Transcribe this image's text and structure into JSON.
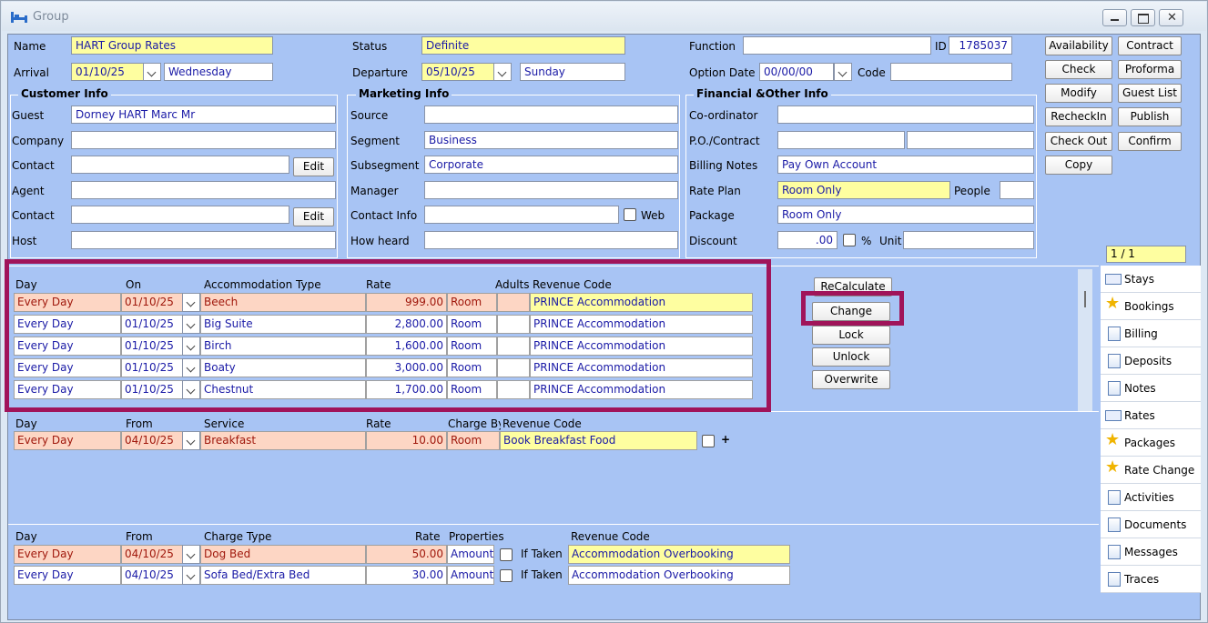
{
  "window": {
    "title": "Group"
  },
  "header": {
    "name_label": "Name",
    "name_value": "HART Group Rates",
    "status_label": "Status",
    "status_value": "Definite",
    "function_label": "Function",
    "function_value": "",
    "id_label": "ID",
    "id_value": "1785037",
    "arrival_label": "Arrival",
    "arrival_date": "01/10/25",
    "arrival_day": "Wednesday",
    "departure_label": "Departure",
    "departure_date": "05/10/25",
    "departure_day": "Sunday",
    "option_date_label": "Option Date",
    "option_date_value": "00/00/00",
    "code_label": "Code",
    "code_value": ""
  },
  "customer": {
    "title": "Customer Info",
    "guest_label": "Guest",
    "guest_value": "Dorney HART Marc Mr",
    "company_label": "Company",
    "company_value": "",
    "contact_label": "Contact",
    "contact_value": "",
    "edit1": "Edit",
    "agent_label": "Agent",
    "agent_value": "",
    "contact2_label": "Contact",
    "contact2_value": "",
    "edit2": "Edit",
    "host_label": "Host",
    "host_value": ""
  },
  "marketing": {
    "title": "Marketing Info",
    "source_label": "Source",
    "source_value": "",
    "segment_label": "Segment",
    "segment_value": "Business",
    "subsegment_label": "Subsegment",
    "subsegment_value": "Corporate",
    "manager_label": "Manager",
    "manager_value": "",
    "contactinfo_label": "Contact Info",
    "contactinfo_value": "",
    "web_label": "Web",
    "howheard_label": "How heard",
    "howheard_value": ""
  },
  "financial": {
    "title": "Financial &Other Info",
    "coordinator_label": "Co-ordinator",
    "coordinator_value": "",
    "po_label": "P.O./Contract",
    "po_value": "",
    "po_value2": "",
    "billing_label": "Billing Notes",
    "billing_value": "Pay Own Account",
    "rateplan_label": "Rate Plan",
    "rateplan_value": "Room Only",
    "people_label": "People",
    "people_value": "",
    "package_label": "Package",
    "package_value": "Room Only",
    "discount_label": "Discount",
    "discount_value": ".00",
    "pct_label": "%",
    "unit_label": "Unit",
    "unit_value": ""
  },
  "actions": {
    "availability": "Availability",
    "contract": "Contract",
    "check": "Check",
    "proforma": "Proforma",
    "modify": "Modify",
    "guest_list": "Guest List",
    "recheckin": "RecheckIn",
    "publish": "Publish",
    "check_out": "Check Out",
    "confirm": "Confirm",
    "copy": "Copy"
  },
  "pager": "1 / 1",
  "accommodation": {
    "headers": {
      "day": "Day",
      "on": "On",
      "type": "Accommodation Type",
      "rate": "Rate",
      "adults": "Adults",
      "revenue": "Revenue Code"
    },
    "rows": [
      {
        "day": "Every Day",
        "on": "01/10/25",
        "type": "Beech",
        "rate": "999.00",
        "unit": "Room",
        "adults": "",
        "revenue": "PRINCE Accommodation"
      },
      {
        "day": "Every Day",
        "on": "01/10/25",
        "type": "Big Suite",
        "rate": "2,800.00",
        "unit": "Room",
        "adults": "",
        "revenue": "PRINCE Accommodation"
      },
      {
        "day": "Every Day",
        "on": "01/10/25",
        "type": "Birch",
        "rate": "1,600.00",
        "unit": "Room",
        "adults": "",
        "revenue": "PRINCE Accommodation"
      },
      {
        "day": "Every Day",
        "on": "01/10/25",
        "type": "Boaty",
        "rate": "3,000.00",
        "unit": "Room",
        "adults": "",
        "revenue": "PRINCE Accommodation"
      },
      {
        "day": "Every Day",
        "on": "01/10/25",
        "type": "Chestnut",
        "rate": "1,700.00",
        "unit": "Room",
        "adults": "",
        "revenue": "PRINCE Accommodation"
      }
    ],
    "recalculate": "ReCalculate",
    "change": "Change",
    "lock": "Lock",
    "unlock": "Unlock",
    "overwrite": "Overwrite"
  },
  "services": {
    "headers": {
      "day": "Day",
      "from": "From",
      "service": "Service",
      "rate": "Rate",
      "charge_by": "Charge By",
      "revenue": "Revenue Code"
    },
    "rows": [
      {
        "day": "Every Day",
        "from": "04/10/25",
        "service": "Breakfast",
        "rate": "10.00",
        "unit": "Room",
        "revenue": "Book Breakfast Food",
        "plus": "+"
      }
    ]
  },
  "charges": {
    "headers": {
      "day": "Day",
      "from": "From",
      "type": "Charge Type",
      "rate": "Rate",
      "properties": "Properties",
      "revenue": "Revenue Code"
    },
    "rows": [
      {
        "day": "Every Day",
        "from": "04/10/25",
        "type": "Dog Bed",
        "rate": "50.00",
        "unit": "Amount",
        "iftaken": "If Taken",
        "revenue": "Accommodation Overbooking"
      },
      {
        "day": "Every Day",
        "from": "04/10/25",
        "type": "Sofa Bed/Extra Bed",
        "rate": "30.00",
        "unit": "Amount",
        "iftaken": "If Taken",
        "revenue": "Accommodation Overbooking"
      }
    ]
  },
  "sidebar": {
    "items": [
      {
        "label": "Stays",
        "icon": "message-icon"
      },
      {
        "label": "Bookings",
        "icon": "star-icon"
      },
      {
        "label": "Billing",
        "icon": "document-icon"
      },
      {
        "label": "Deposits",
        "icon": "document-icon"
      },
      {
        "label": "Notes",
        "icon": "document-icon"
      },
      {
        "label": "Rates",
        "icon": "message-icon"
      },
      {
        "label": "Packages",
        "icon": "star-icon"
      },
      {
        "label": "Rate Change",
        "icon": "star-icon"
      },
      {
        "label": "Activities",
        "icon": "document-icon"
      },
      {
        "label": "Documents",
        "icon": "document-icon"
      },
      {
        "label": "Messages",
        "icon": "document-icon"
      },
      {
        "label": "Traces",
        "icon": "document-icon"
      }
    ]
  },
  "colors": {
    "highlight": "#a0145a",
    "background": "#a8c4f4",
    "yellow_field": "#fefea0",
    "pink_row": "#fdd6c4"
  }
}
